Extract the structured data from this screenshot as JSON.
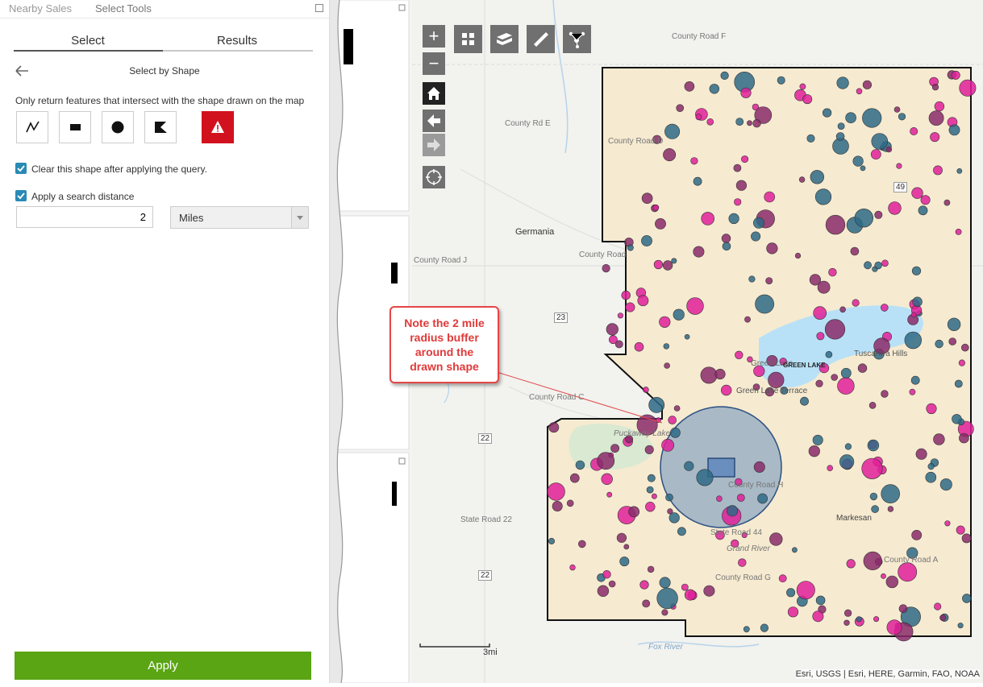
{
  "window": {
    "tabs": [
      "Nearby Sales",
      "Select Tools"
    ]
  },
  "panel": {
    "tabs": [
      {
        "label": "Select"
      },
      {
        "label": "Results"
      }
    ],
    "title": "Select by Shape",
    "instruction": "Only return features that intersect with the shape drawn on the map",
    "shape_tools": [
      "polyline-icon",
      "rectangle-icon",
      "circle-icon",
      "polygon-icon",
      "warning-icon"
    ],
    "clear_label": "Clear this shape after applying the query.",
    "distance_label": "Apply a search distance",
    "distance_value": "2",
    "unit": "Miles",
    "apply_label": "Apply"
  },
  "map": {
    "labels": [
      "County Road F",
      "County Rd E",
      "County Road D",
      "Germania",
      "County Road J",
      "County Road",
      "Green Lake",
      "GREEN LAKE",
      "Tuscarora Hills",
      "Green Lake Terrace",
      "County Road C",
      "Puckaway Lake",
      "County Road H",
      "State Road 44",
      "Grand River",
      "County Road G",
      "Markesan",
      "State Road 22",
      "County Road A",
      "Fox River"
    ],
    "highway_shields": [
      "49",
      "23",
      "22",
      "22"
    ],
    "note": "Note the 2 mile radius buffer around the drawn shape",
    "scale": "3mi",
    "attribution": "Esri, USGS | Esri, HERE, Garmin, FAO, NOAA",
    "colors": {
      "county_fill": "#f6ead0",
      "buffer": "#6a8fbe",
      "note_border": "#e64545",
      "apply": "#5aa513"
    }
  }
}
